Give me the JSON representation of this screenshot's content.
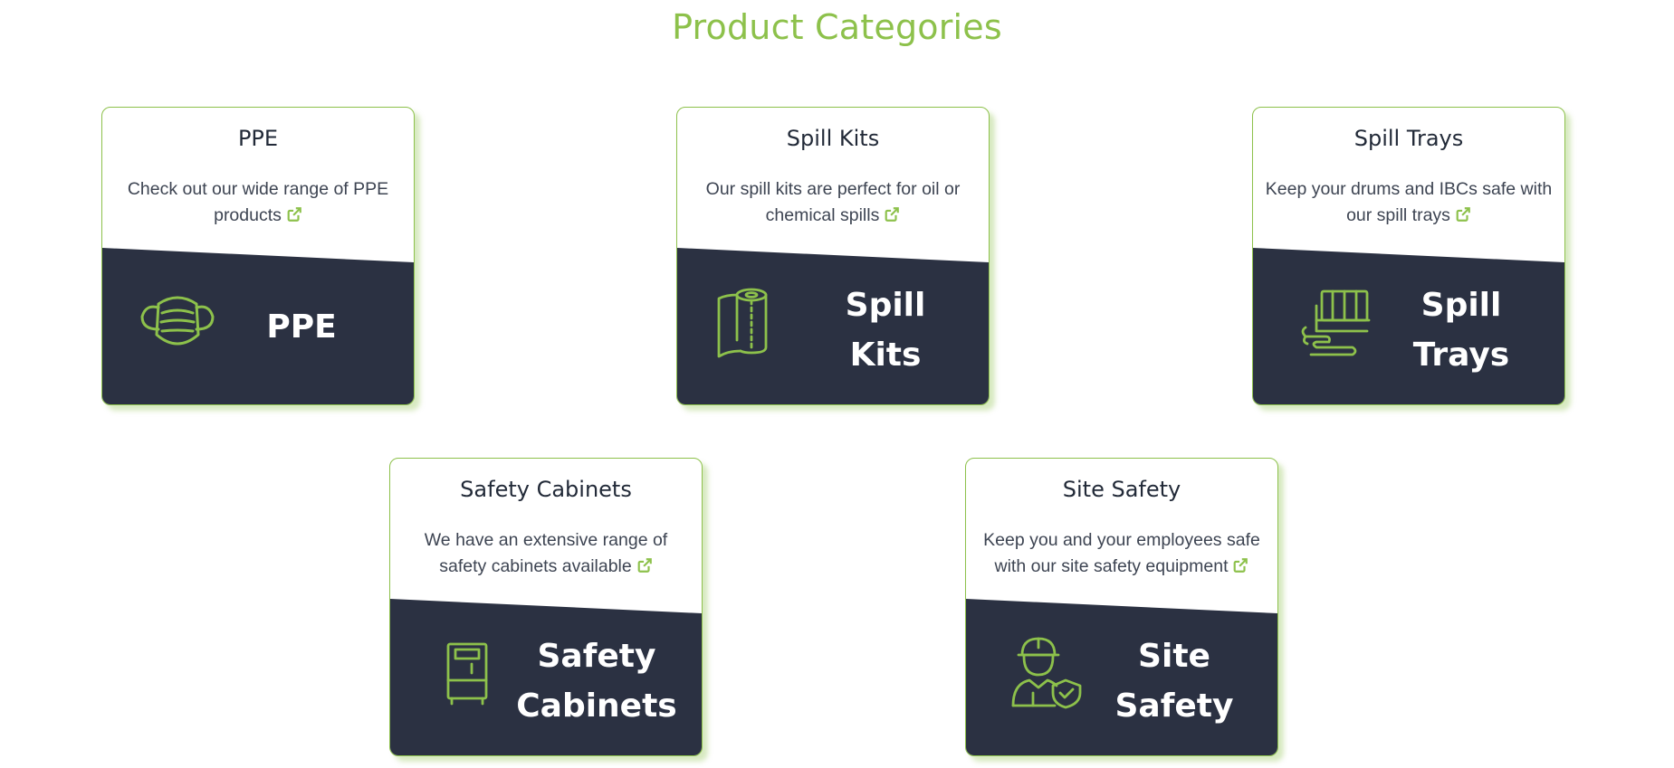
{
  "section": {
    "title": "Product Categories"
  },
  "colors": {
    "accent": "#8dc14b",
    "panel": "#2b3142",
    "text": "#222a38"
  },
  "cards": [
    {
      "title": "PPE",
      "description": "Check out our wide range of PPE products",
      "panel_label": "PPE",
      "icon": "face-mask-icon"
    },
    {
      "title": "Spill Kits",
      "description": "Our spill kits are perfect for oil or chemical spills",
      "panel_label": "Spill\nKits",
      "icon": "absorbent-roll-icon"
    },
    {
      "title": "Spill Trays",
      "description": "Keep your drums and IBCs safe with our spill trays",
      "panel_label": "Spill\nTrays",
      "icon": "spill-tray-icon"
    },
    {
      "title": "Safety Cabinets",
      "description": "We have an extensive range of safety cabinets available",
      "panel_label": "Safety\nCabinets",
      "icon": "safety-cabinet-icon"
    },
    {
      "title": "Site Safety",
      "description": "Keep you and your employees safe with our site safety equipment",
      "panel_label": "Site\nSafety",
      "icon": "worker-helmet-icon"
    }
  ]
}
